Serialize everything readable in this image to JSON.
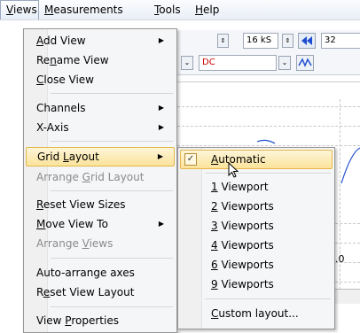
{
  "menubar": {
    "items": [
      {
        "label": "Views",
        "underline": "V"
      },
      {
        "label": "Measurements",
        "underline": "M"
      },
      {
        "label": "Tools",
        "underline": "T"
      },
      {
        "label": "Help",
        "underline": "H"
      }
    ]
  },
  "toolbar": {
    "sample_count": "16 kS",
    "coupling": "DC",
    "value_partial": "32"
  },
  "plot": {
    "axis_partial": "0"
  },
  "views_menu": {
    "items": [
      {
        "label": "Add View",
        "submenu": true
      },
      {
        "label": "Rename View"
      },
      {
        "label": "Close View"
      },
      {
        "label": "Channels",
        "submenu": true
      },
      {
        "label": "X-Axis",
        "submenu": true
      },
      {
        "label": "Grid Layout",
        "submenu": true,
        "highlighted": true
      },
      {
        "label": "Arrange Grid Layout",
        "disabled": true
      },
      {
        "label": "Reset View Sizes"
      },
      {
        "label": "Move View To",
        "submenu": true
      },
      {
        "label": "Arrange Views",
        "disabled": true
      },
      {
        "label": "Auto-arrange axes"
      },
      {
        "label": "Reset View Layout"
      },
      {
        "label": "View Properties"
      }
    ]
  },
  "grid_layout_submenu": {
    "items": [
      {
        "label": "Automatic",
        "checked": true,
        "highlighted": true
      },
      {
        "label": "1 Viewport"
      },
      {
        "label": "2 Viewports"
      },
      {
        "label": "3 Viewports"
      },
      {
        "label": "4 Viewports"
      },
      {
        "label": "6 Viewports"
      },
      {
        "label": "9 Viewports"
      },
      {
        "label": "Custom layout..."
      }
    ]
  },
  "colors": {
    "highlight": "#fbe39a",
    "signal_trace": "#1f4fd1",
    "coupling_text": "#cc0000"
  }
}
